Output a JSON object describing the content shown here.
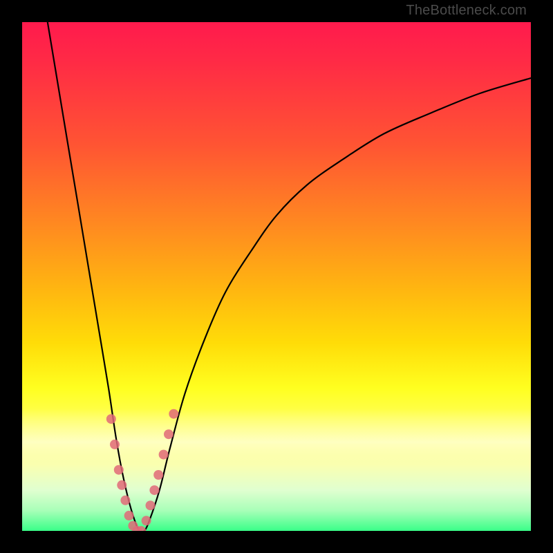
{
  "watermark": "TheBottleneck.com",
  "chart_data": {
    "type": "line",
    "title": "",
    "xlabel": "",
    "ylabel": "",
    "xlim": [
      0,
      100
    ],
    "ylim": [
      0,
      100
    ],
    "grid": false,
    "series": [
      {
        "name": "bottleneck-curve",
        "x": [
          5,
          7,
          9,
          11,
          13,
          15,
          17,
          18.5,
          20,
          21.5,
          23,
          24,
          25,
          27,
          29,
          32,
          36,
          40,
          45,
          50,
          56,
          63,
          71,
          80,
          90,
          100
        ],
        "y": [
          100,
          88,
          76,
          64,
          52,
          40,
          28,
          18,
          10,
          4,
          0,
          0,
          2,
          8,
          16,
          27,
          38,
          47,
          55,
          62,
          68,
          73,
          78,
          82,
          86,
          89
        ]
      }
    ],
    "markers": {
      "name": "highlighted-points",
      "color": "#e06a78",
      "points": [
        {
          "x": 17.5,
          "y": 22
        },
        {
          "x": 18.2,
          "y": 17
        },
        {
          "x": 19.0,
          "y": 12
        },
        {
          "x": 19.6,
          "y": 9
        },
        {
          "x": 20.3,
          "y": 6
        },
        {
          "x": 21.0,
          "y": 3
        },
        {
          "x": 21.8,
          "y": 1
        },
        {
          "x": 22.6,
          "y": 0
        },
        {
          "x": 23.4,
          "y": 0
        },
        {
          "x": 24.4,
          "y": 2
        },
        {
          "x": 25.2,
          "y": 5
        },
        {
          "x": 26.0,
          "y": 8
        },
        {
          "x": 26.8,
          "y": 11
        },
        {
          "x": 27.8,
          "y": 15
        },
        {
          "x": 28.8,
          "y": 19
        },
        {
          "x": 29.8,
          "y": 23
        }
      ]
    },
    "background_gradient": {
      "top": "#ff1a4d",
      "mid": "#ffff20",
      "bottom": "#39ff88"
    }
  }
}
